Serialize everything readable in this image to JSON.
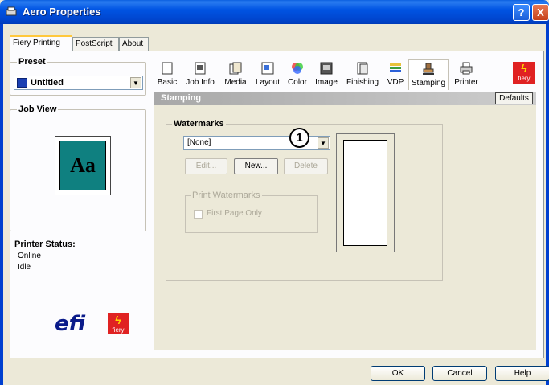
{
  "window": {
    "title": "Aero Properties",
    "help_btn": "?",
    "close_btn": "X"
  },
  "tabs": [
    "Fiery Printing",
    "PostScript",
    "About"
  ],
  "preset": {
    "title": "Preset",
    "value": "Untitled"
  },
  "job_view": {
    "title": "Job View",
    "preview_text": "Aa"
  },
  "printer_status": {
    "title": "Printer Status:",
    "lines": [
      "Online",
      "Idle"
    ]
  },
  "logos": {
    "efi": "efi",
    "fiery": "fiery"
  },
  "toolbar": [
    {
      "label": "Basic",
      "icon": "page-icon"
    },
    {
      "label": "Job Info",
      "icon": "job-info-icon"
    },
    {
      "label": "Media",
      "icon": "media-icon"
    },
    {
      "label": "Layout",
      "icon": "layout-icon"
    },
    {
      "label": "Color",
      "icon": "color-icon"
    },
    {
      "label": "Image",
      "icon": "image-icon"
    },
    {
      "label": "Finishing",
      "icon": "finishing-icon"
    },
    {
      "label": "VDP",
      "icon": "vdp-icon"
    },
    {
      "label": "Stamping",
      "icon": "stamping-icon"
    },
    {
      "label": "Printer",
      "icon": "printer-icon"
    }
  ],
  "section": {
    "title": "Stamping",
    "defaults_btn": "Defaults"
  },
  "watermarks": {
    "title": "Watermarks",
    "selected": "[None]",
    "callout": "1",
    "edit_btn": "Edit...",
    "new_btn": "New...",
    "delete_btn": "Delete",
    "print_title": "Print Watermarks",
    "first_page_label": "First Page Only"
  },
  "footer": {
    "ok": "OK",
    "cancel": "Cancel",
    "help": "Help"
  }
}
